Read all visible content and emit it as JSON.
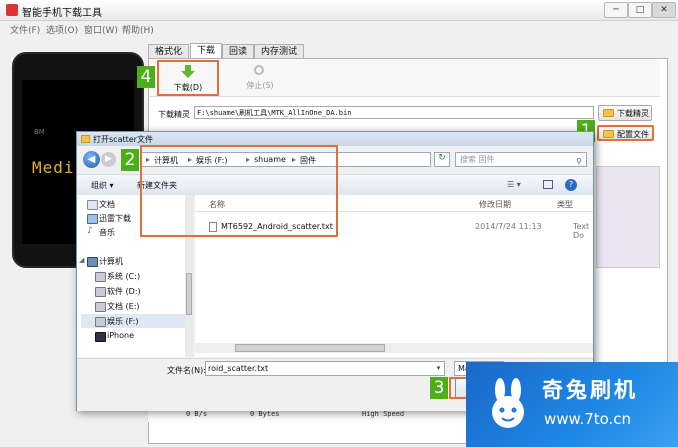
{
  "app": {
    "title": "智能手机下载工具",
    "minimize": "─",
    "maximize": "□",
    "close": "✕"
  },
  "menu": [
    "文件(F)",
    "选项(O)",
    "窗口(W)",
    "帮助(H)"
  ],
  "phone": {
    "screen_text": "Medi",
    "logo_text": "BM"
  },
  "tabs": [
    "格式化",
    "下载",
    "回读",
    "内存测试"
  ],
  "toolbar": {
    "download_label": "下载(D)",
    "stop_label": "停止(S)"
  },
  "download_agent": {
    "label": "下载精灵",
    "value": "F:\\shuame\\刷机工具\\MTK_AllInOne_DA.bin",
    "button": "下载精灵"
  },
  "scatter": {
    "button": "配置文件"
  },
  "status_bar": [
    "0 B/s",
    "0 Bytes",
    "High Speed"
  ],
  "badges": {
    "step1": "1",
    "step2": "2",
    "step3": "3",
    "step4": "4"
  },
  "dialog": {
    "title": "打开scatter文件",
    "breadcrumbs": [
      "计算机",
      "娱乐 (F:)",
      "shuame",
      "固件"
    ],
    "search_placeholder": "搜索 固件",
    "organize": "组织 ▾",
    "new_folder": "新建文件夹",
    "nav_favorites": [
      "文档",
      "迅雷下载",
      "音乐"
    ],
    "nav_computer_header": "计算机",
    "nav_drives": [
      "系统 (C:)",
      "软件 (D:)",
      "文档 (E:)",
      "娱乐 (F:)",
      "iPhone"
    ],
    "columns": {
      "name": "名称",
      "date": "修改日期",
      "type": "类型"
    },
    "file": {
      "name": "MT6592_Android_scatter.txt",
      "date": "2014/7/24 11:13",
      "type": "Text Do"
    },
    "filename_label": "文件名(N):",
    "filename_value": "roid_scatter.txt",
    "filter_value": "Map"
  },
  "watermark": {
    "brand": "奇兔刷机",
    "url": "www.7to.cn"
  },
  "colors": {
    "highlight": "#e0703a",
    "badge": "#4caf1a",
    "watermark_bg": "#1e88e5"
  }
}
